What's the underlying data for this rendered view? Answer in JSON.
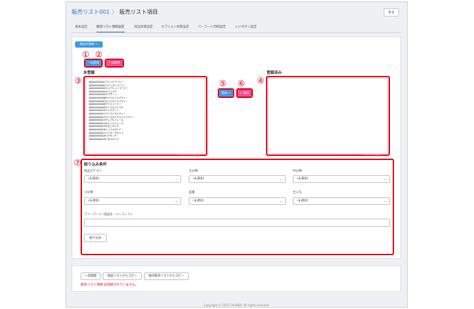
{
  "header": {
    "breadcrumb_link": "販売リスト001",
    "breadcrumb_sep": "〉",
    "page_title": "販売リスト項目",
    "back_label": "戻る"
  },
  "tabs": [
    {
      "label": "基本設定"
    },
    {
      "label": "販売リスト項目設定",
      "active": true
    },
    {
      "label": "商品状態設定"
    },
    {
      "label": "オプション状態設定"
    },
    {
      "label": "バーコード印刷設定"
    },
    {
      "label": "レジボタン設定"
    }
  ],
  "toolbar": {
    "product_register_label": "商品の登録 ～",
    "bulk_register_label": "一括登録",
    "bulk_delete_label": "一括削除"
  },
  "annotations": {
    "n1": "①",
    "n2": "②",
    "n3": "③",
    "n4": "④",
    "n5": "⑤",
    "n6": "⑥",
    "n7": "⑦"
  },
  "unregistered": {
    "heading": "未登録",
    "items": [
      "J00000000001ブレンドコーヒー",
      "J00000000002アメリカンコーヒー",
      "J00000000003エスプレッソコーヒー",
      "J00000000004カフェラテ",
      "J00000000005カプチーノ",
      "J00000000006ロイヤルミルクティー",
      "J00000000007ロイヤルミルクティー",
      "J00000000008アイスコーヒー",
      "J00000000009アイスカフェラテ",
      "J00000000010アイスティー",
      "J00000000011アイスレモンティー",
      "J00000000012アイスロイヤルミルクティー",
      "J00000000013アップルジュース",
      "J00000000014オレンジジュース",
      "J00000000015たまごサンド",
      "J00000000016ミックスサンド",
      "J00000000017ハムチーズサンド",
      "J00000000018ツナサンド",
      "J00000000019レタスサンド"
    ],
    "count_label": "(19 件中 19 件表示)"
  },
  "registered": {
    "heading": "登録済み",
    "items": [],
    "count_label": "(0 件中 0 件表示)"
  },
  "transfer": {
    "add_label": "登録 →",
    "remove_label": "← 削除"
  },
  "filter": {
    "heading": "絞り込み条件",
    "fields": [
      {
        "label": "商品カテゴリ",
        "value": "(未選択)"
      },
      {
        "label": "大分類",
        "value": "(未選択)"
      },
      {
        "label": "中分類",
        "value": "(未選択)"
      },
      {
        "label": "小分類",
        "value": "(未選択)"
      },
      {
        "label": "品番",
        "value": "(未選択)"
      },
      {
        "label": "仕入先",
        "value": "(未選択)"
      }
    ],
    "freeword_label": "フリーワード (商品名・バーコード)",
    "freeword_value": "",
    "submit_label": "絞り込み"
  },
  "bottom": {
    "bulk_register_label": "一括登録",
    "copy_from_product_list_label": "商品リストからコピー",
    "copy_from_other_list_label": "他の販売リストからコピー",
    "error_message": "販売リスト項目 は登録されていません。"
  },
  "footer": {
    "copyright": "Copyright © 2025 CASHIER. All rights reserved."
  },
  "colors": {
    "primary_blue": "#3d9ae6",
    "link_blue": "#2b7bd3",
    "danger_pink": "#ef4f8f",
    "annotation_red": "#e8001c"
  }
}
